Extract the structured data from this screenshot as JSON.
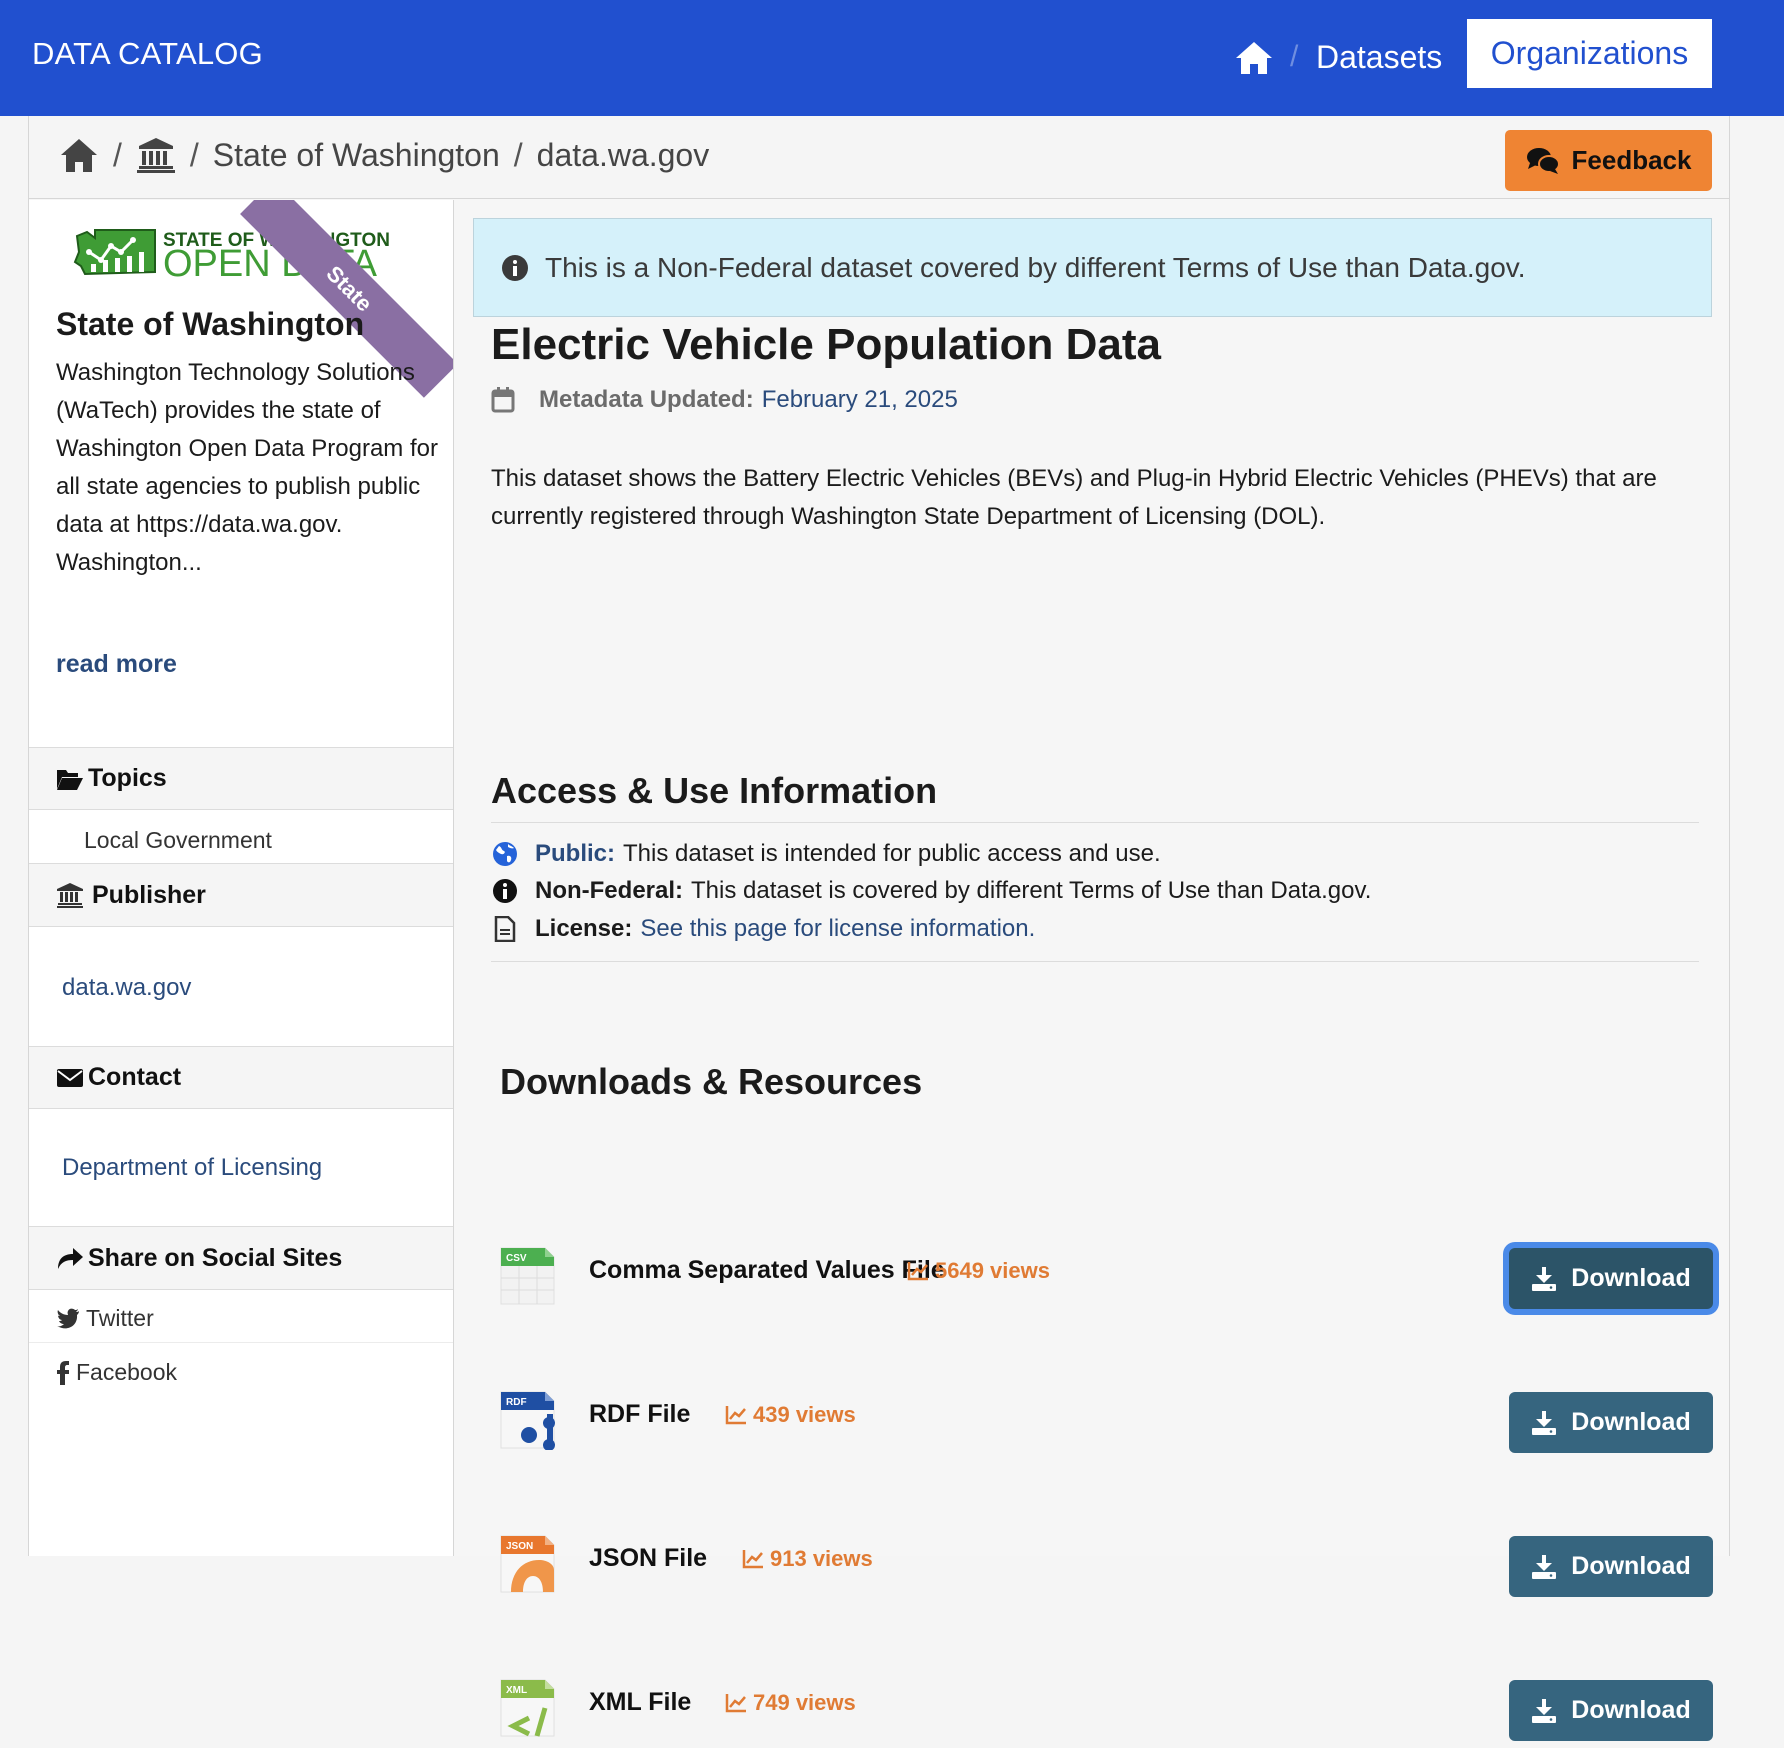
{
  "header": {
    "brand": "DATA CATALOG",
    "nav_home_icon": "home-icon",
    "nav_separator": "/",
    "nav_datasets": "Datasets",
    "nav_organizations": "Organizations",
    "bg_color": "#2150cf"
  },
  "breadcrumb": {
    "home_icon": "home-icon",
    "org_icon": "institution-icon",
    "separator": "/",
    "items": [
      "State of Washington",
      "data.wa.gov"
    ]
  },
  "feedback": {
    "label": "Feedback",
    "icon": "comments-icon",
    "color": "#ef8433"
  },
  "sidebar": {
    "logo": {
      "line1": "STATE OF WASHINGTON",
      "line2": "OPEN DATA"
    },
    "ribbon": "State",
    "org_name": "State of Washington",
    "org_description": "Washington Technology Solutions (WaTech) provides the state of Washington Open Data Program for all state agencies to publish public data at https://data.wa.gov. Washington...",
    "read_more": "read more",
    "topics": {
      "heading": "Topics",
      "items": [
        "Local Government"
      ]
    },
    "publisher": {
      "heading": "Publisher",
      "value": "data.wa.gov"
    },
    "contact": {
      "heading": "Contact",
      "value": "Department of Licensing"
    },
    "share": {
      "heading": "Share on Social Sites",
      "items": [
        "Twitter",
        "Facebook"
      ]
    }
  },
  "main": {
    "alert": "This is a Non-Federal dataset covered by different Terms of Use than Data.gov.",
    "title": "Electric Vehicle Population Data",
    "metadata_label": "Metadata Updated:",
    "metadata_date": "February 21, 2025",
    "description": "This dataset shows the Battery Electric Vehicles (BEVs) and Plug-in Hybrid Electric Vehicles (PHEVs) that are currently registered through Washington State Department of Licensing (DOL).",
    "access": {
      "heading": "Access & Use Information",
      "items": [
        {
          "label": "Public:",
          "text": "This dataset is intended for public access and use."
        },
        {
          "label": "Non-Federal:",
          "text": "This dataset is covered by different Terms of Use than Data.gov."
        },
        {
          "label": "License:",
          "text": "See this page for license information."
        }
      ]
    },
    "downloads": {
      "heading": "Downloads & Resources",
      "button_label": "Download",
      "resources": [
        {
          "format": "CSV",
          "title": "Comma Separated Values File",
          "views": "5649 views",
          "color": "#4caf50"
        },
        {
          "format": "RDF",
          "title": "RDF File",
          "views": "439 views",
          "color": "#1f4fa3"
        },
        {
          "format": "JSON",
          "title": "JSON File",
          "views": "913 views",
          "color": "#e8772e"
        },
        {
          "format": "XML",
          "title": "XML File",
          "views": "749 views",
          "color": "#8bbb4a"
        }
      ]
    }
  }
}
